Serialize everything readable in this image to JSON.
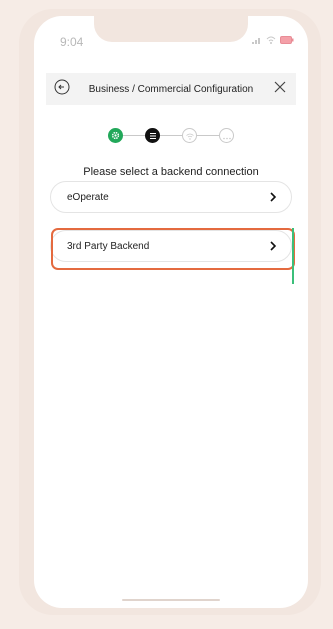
{
  "status_bar": {
    "time": "9:04"
  },
  "header": {
    "title": "Business / Commercial Configuration"
  },
  "stepper": {
    "steps": [
      {
        "state": "completed",
        "icon": "gear-icon",
        "color": "#22a85a"
      },
      {
        "state": "current",
        "icon": "list-icon",
        "color": "#111111"
      },
      {
        "state": "upcoming",
        "icon": "wifi-icon",
        "color": "#c9c9c9"
      },
      {
        "state": "upcoming",
        "icon": "ellipsis-icon",
        "color": "#c9c9c9"
      }
    ]
  },
  "main": {
    "prompt": "Please select a backend connection",
    "options": [
      {
        "label": "eOperate"
      },
      {
        "label": "3rd Party Backend",
        "highlighted": true
      }
    ]
  },
  "colors": {
    "highlight": "#e46a3f",
    "accent_green": "#22a85a",
    "background": "#f6ece6"
  }
}
